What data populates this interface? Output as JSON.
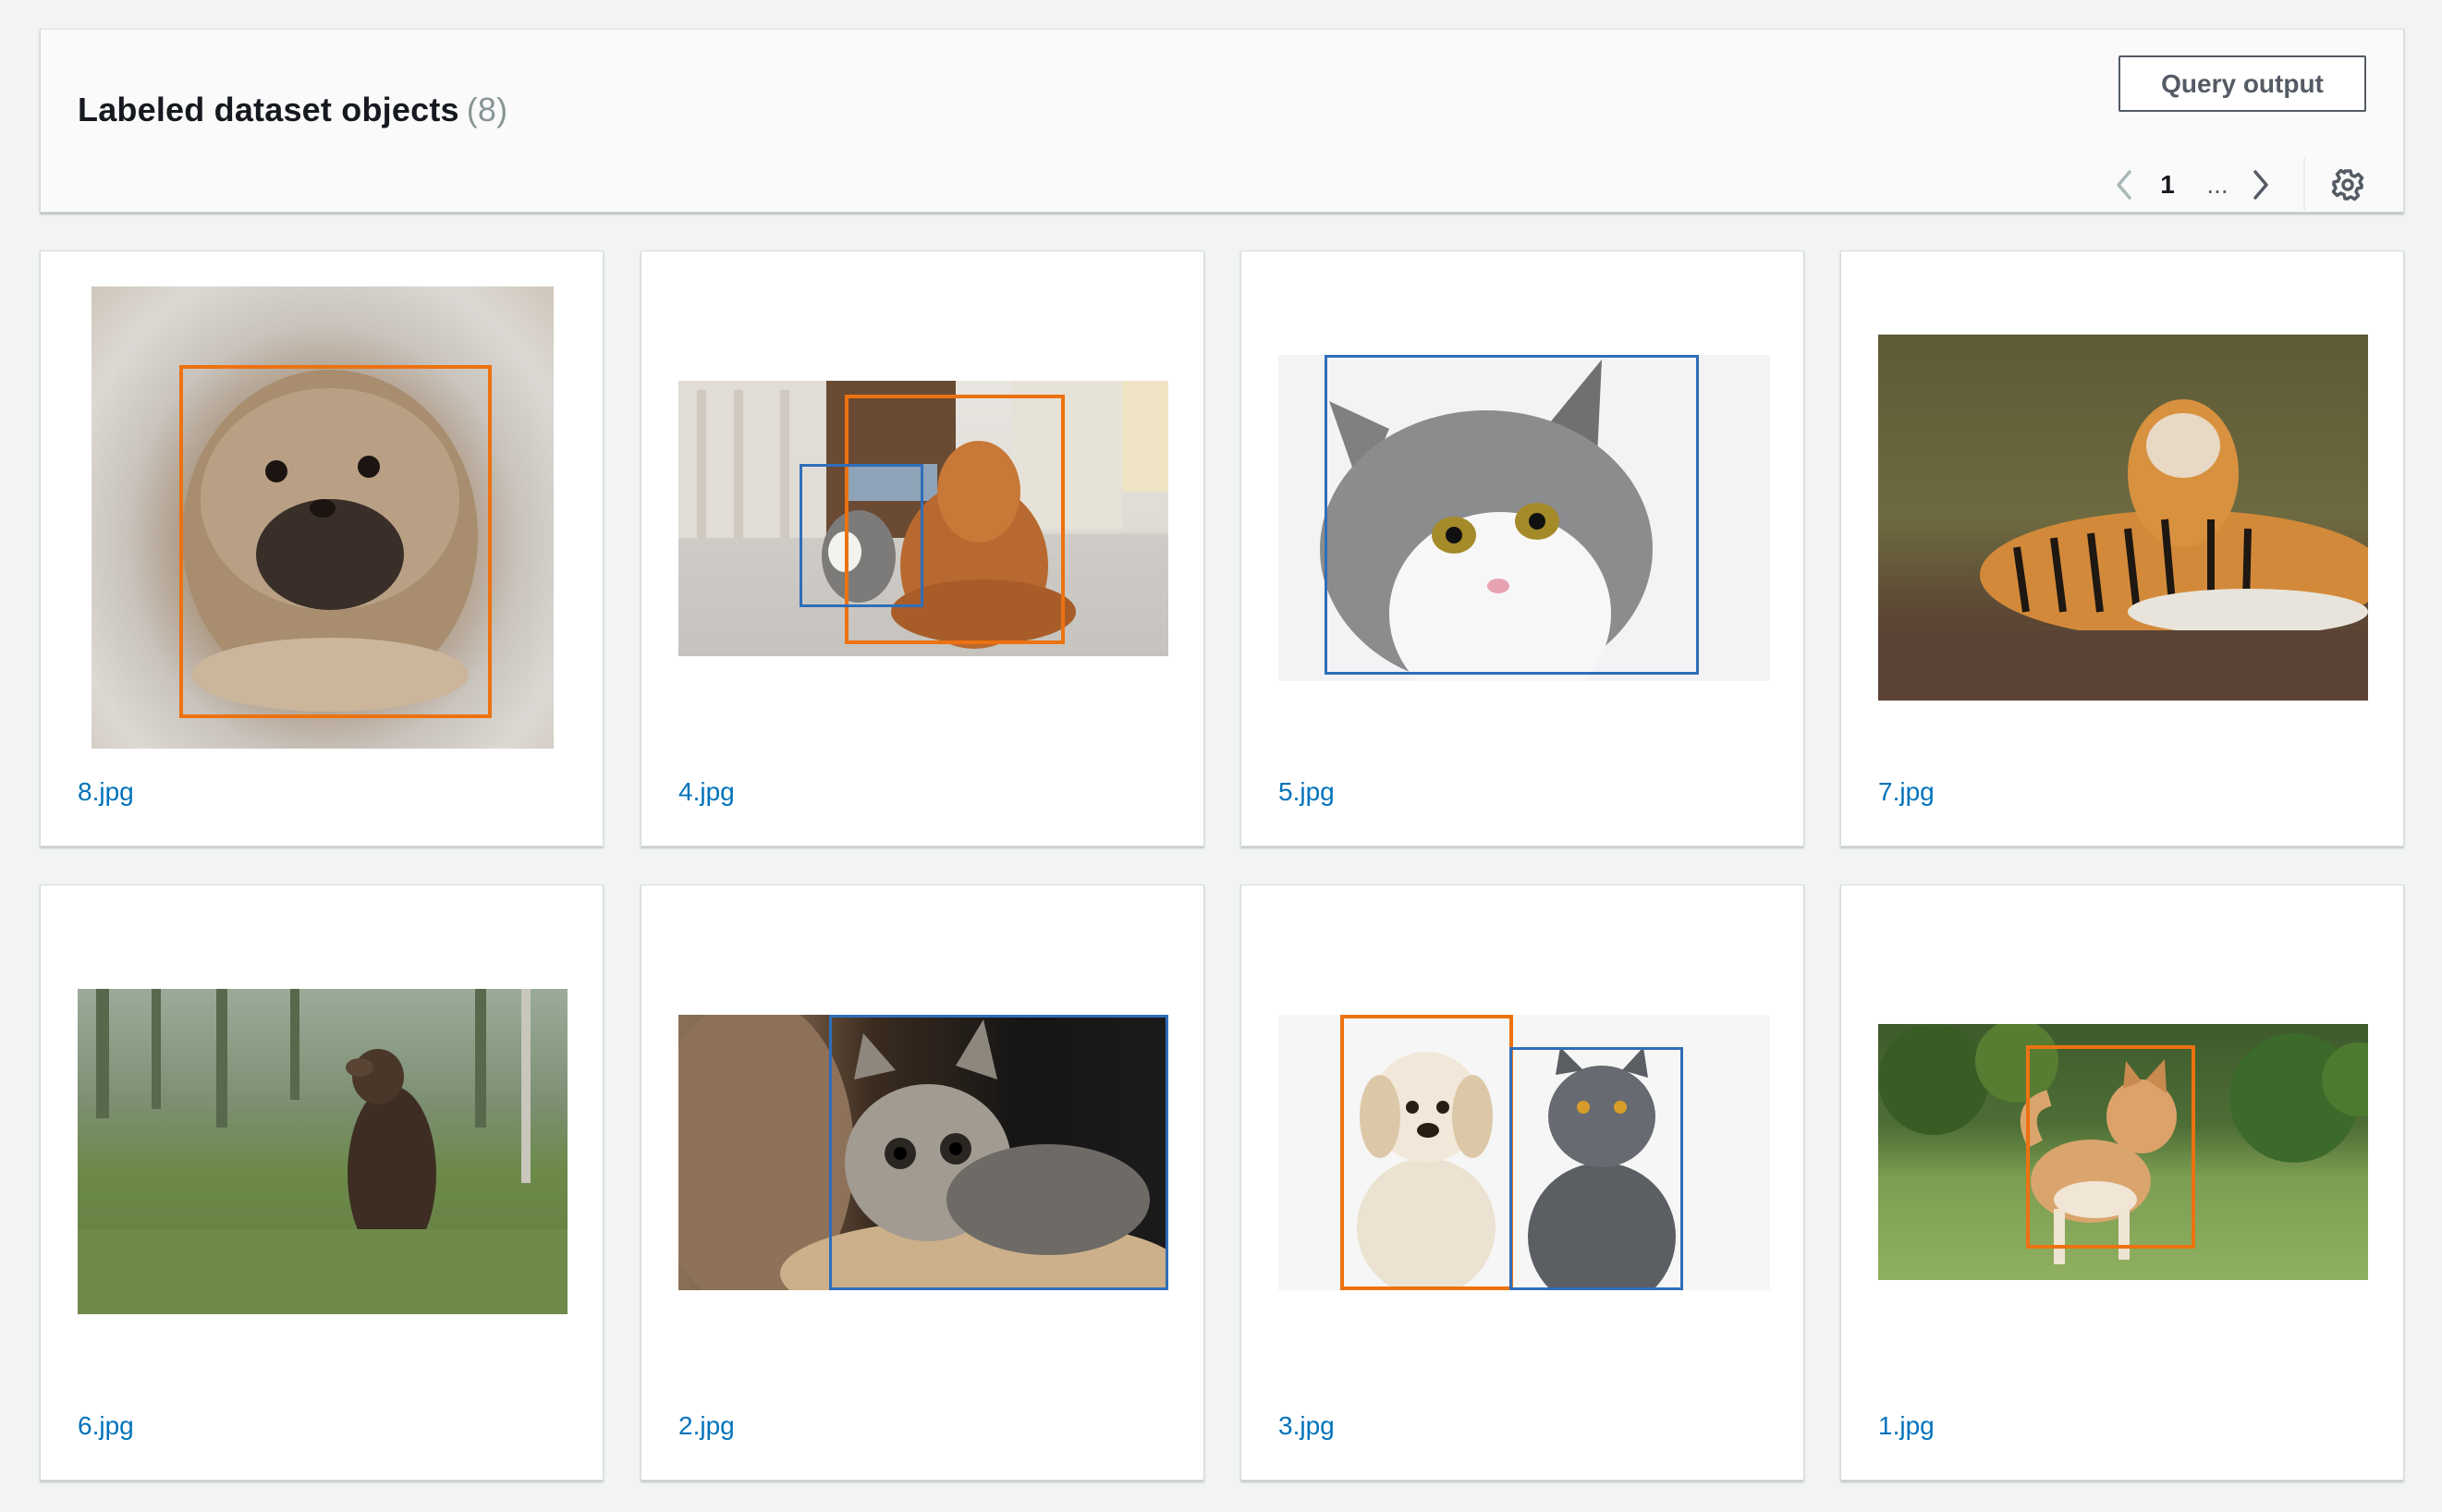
{
  "header": {
    "title": "Labeled dataset objects",
    "count": "(8)",
    "query_button": "Query output",
    "pagination": {
      "current_page": "1",
      "ellipsis": "..."
    }
  },
  "colors": {
    "label_class_a": "#ec7211",
    "label_class_b": "#2f6eba",
    "link": "#0073bb"
  },
  "cards": [
    {
      "filename": "8.jpg",
      "subject": "fluffy-dog"
    },
    {
      "filename": "4.jpg",
      "subject": "dog-and-cat-indoors"
    },
    {
      "filename": "5.jpg",
      "subject": "grey-white-cat"
    },
    {
      "filename": "7.jpg",
      "subject": "tiger"
    },
    {
      "filename": "6.jpg",
      "subject": "standing-bear"
    },
    {
      "filename": "2.jpg",
      "subject": "tabby-cat"
    },
    {
      "filename": "3.jpg",
      "subject": "puppy-and-grey-cat"
    },
    {
      "filename": "1.jpg",
      "subject": "shiba-dog"
    }
  ]
}
